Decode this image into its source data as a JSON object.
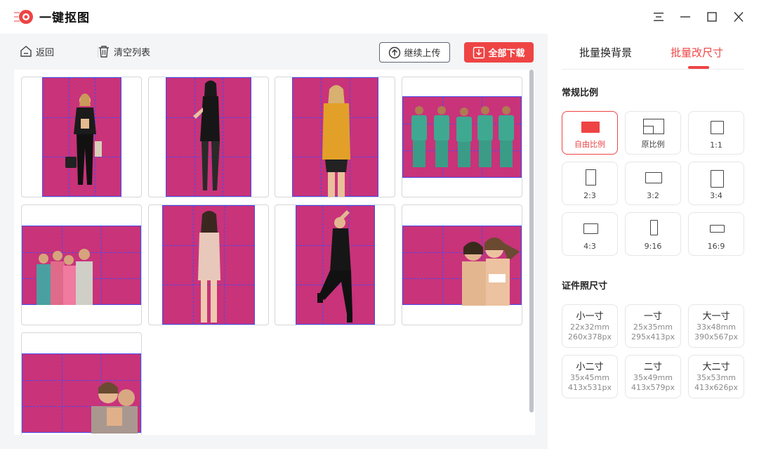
{
  "app": {
    "title": "一键抠图"
  },
  "window": {
    "menu_icon": "menu-icon",
    "minimize_icon": "minimize-icon",
    "maximize_icon": "maximize-icon",
    "close_icon": "close-icon"
  },
  "toolbar": {
    "back_label": "返回",
    "clear_label": "清空列表",
    "upload_label": "继续上传",
    "download_label": "全部下载"
  },
  "colors": {
    "accent": "#ee4444",
    "crop_bg": "#c8337a",
    "guide": "#4a4af0"
  },
  "images": [
    {
      "subject": "woman-leather-jacket",
      "orientation": "portrait"
    },
    {
      "subject": "woman-black-dress",
      "orientation": "portrait"
    },
    {
      "subject": "woman-yellow-sweater",
      "orientation": "portrait"
    },
    {
      "subject": "medical-team-group",
      "orientation": "landscape"
    },
    {
      "subject": "family-group",
      "orientation": "landscape"
    },
    {
      "subject": "woman-beige-dress",
      "orientation": "portrait"
    },
    {
      "subject": "woman-black-outfit-posing",
      "orientation": "portrait"
    },
    {
      "subject": "couple-smiling",
      "orientation": "landscape"
    },
    {
      "subject": "family-hug",
      "orientation": "landscape"
    }
  ],
  "sidebar": {
    "tabs": [
      {
        "label": "批量换背景",
        "active": false
      },
      {
        "label": "批量改尺寸",
        "active": true
      }
    ],
    "ratio_title": "常规比例",
    "ratios": [
      {
        "label": "自由比例",
        "active": true
      },
      {
        "label": "原比例",
        "active": false
      },
      {
        "label": "1:1",
        "active": false
      },
      {
        "label": "2:3",
        "active": false
      },
      {
        "label": "3:2",
        "active": false
      },
      {
        "label": "3:4",
        "active": false
      },
      {
        "label": "4:3",
        "active": false
      },
      {
        "label": "9:16",
        "active": false
      },
      {
        "label": "16:9",
        "active": false
      }
    ],
    "id_title": "证件照尺寸",
    "id_sizes": [
      {
        "name": "小一寸",
        "mm": "22x32mm",
        "px": "260x378px"
      },
      {
        "name": "一寸",
        "mm": "25x35mm",
        "px": "295x413px"
      },
      {
        "name": "大一寸",
        "mm": "33x48mm",
        "px": "390x567px"
      },
      {
        "name": "小二寸",
        "mm": "35x45mm",
        "px": "413x531px"
      },
      {
        "name": "二寸",
        "mm": "35x49mm",
        "px": "413x579px"
      },
      {
        "name": "大二寸",
        "mm": "35x53mm",
        "px": "413x626px"
      }
    ]
  }
}
